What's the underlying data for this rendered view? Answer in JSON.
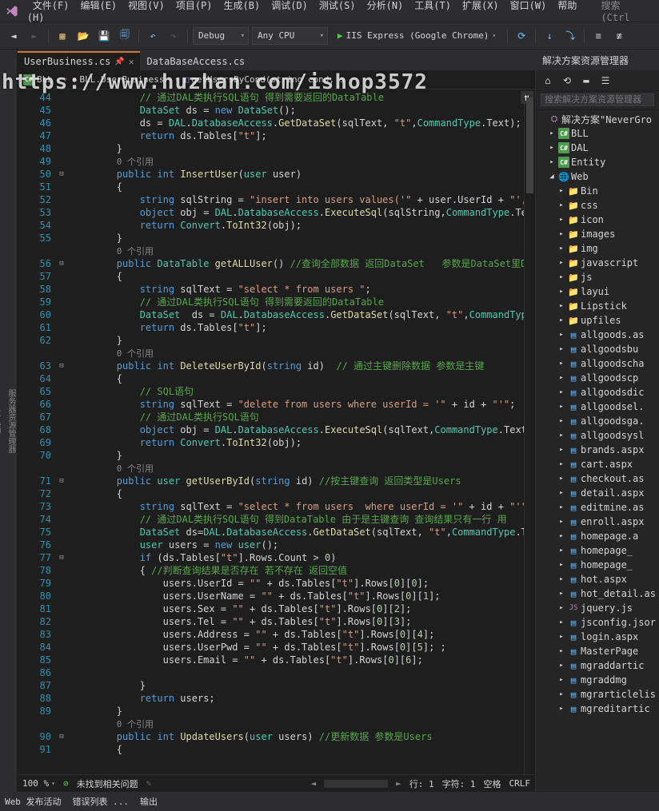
{
  "watermark": "https://www.huzhan.com/ishop3572",
  "menu": [
    "文件(F)",
    "编辑(E)",
    "视图(V)",
    "项目(P)",
    "生成(B)",
    "调试(D)",
    "测试(S)",
    "分析(N)",
    "工具(T)",
    "扩展(X)",
    "窗口(W)",
    "帮助(H)"
  ],
  "searchMenu": "搜索 (Ctrl",
  "toolbar": {
    "config": "Debug",
    "platform": "Any CPU",
    "run": "IIS Express (Google Chrome)"
  },
  "tabs": [
    {
      "label": "UserBusiness.cs",
      "active": true,
      "locked": true
    },
    {
      "label": "DataBaseAccess.cs",
      "active": false,
      "locked": false
    }
  ],
  "breadcrumb": {
    "a": "BLL",
    "b": "BLL.UserBusiness",
    "c": "getUsersByCond(string cond, s"
  },
  "editor_status": {
    "zoom": "100 %",
    "issues": "未找到相关问题",
    "line": "行: 1",
    "col": "字符: 1",
    "ins": "空格",
    "enc": "CRLF"
  },
  "bottom_tabs": [
    "Web 发布活动",
    "错误列表 ...",
    "输出"
  ],
  "solution": {
    "title": "解决方案资源管理器",
    "search": "搜索解决方案资源管理器",
    "root": "解决方案\"NeverGro",
    "projects": [
      "BLL",
      "DAL",
      "Entity"
    ],
    "web": "Web",
    "folders": [
      "Bin",
      "css",
      "icon",
      "images",
      "img",
      "javascript",
      "js",
      "layui",
      "Lipstick",
      "upfiles"
    ],
    "files": [
      "allgoods.as",
      "allgoodsbu",
      "allgoodscha",
      "allgoodscp",
      "allgoodsdic",
      "allgoodsel.",
      "allgoodsga.",
      "allgoodsysl",
      "brands.aspx",
      "cart.aspx",
      "checkout.as",
      "detail.aspx",
      "editmine.as",
      "enroll.aspx",
      "homepage.a",
      "homepage_",
      "homepage_",
      "hot.aspx",
      "hot_detail.as",
      "jquery.js",
      "jsconfig.jsor",
      "login.aspx",
      "MasterPage",
      "mgraddartic",
      "mgraddmg",
      "mgrarticlelis",
      "mgreditartic"
    ]
  },
  "code": {
    "start": 44,
    "lines": [
      {
        "n": 44,
        "f": "",
        "t": "            <span class='cmt'>// 通过DAL类执行SQL语句 得到需要返回的DataTable</span>"
      },
      {
        "n": 45,
        "f": "",
        "t": "            <span class='type'>DataSet</span> <span class='id'>ds</span> = <span class='kw'>new</span> <span class='type'>DataSet</span>();"
      },
      {
        "n": 46,
        "f": "",
        "t": "            <span class='id'>ds</span> = <span class='type'>DAL</span>.<span class='type'>DatabaseAccess</span>.<span class='mth'>GetDataSet</span>(<span class='id'>sqlText</span>, <span class='str'>\"t\"</span>,<span class='type'>CommandType</span>.<span class='id'>Text</span>);"
      },
      {
        "n": 47,
        "f": "",
        "t": "            <span class='kw'>return</span> <span class='id'>ds</span>.<span class='id'>Tables</span>[<span class='str'>\"t\"</span>];"
      },
      {
        "n": 48,
        "f": "",
        "t": "        }"
      },
      {
        "n": 49,
        "f": "",
        "t": "        <span class='ref'>0 个引用</span>"
      },
      {
        "n": 50,
        "f": "⊟",
        "t": "        <span class='kw'>public</span> <span class='kw'>int</span> <span class='mth'>InsertUser</span>(<span class='type'>user</span> <span class='id'>user</span>)"
      },
      {
        "n": 51,
        "f": "",
        "t": "        {"
      },
      {
        "n": 52,
        "f": "",
        "t": "            <span class='kw'>string</span> <span class='id'>sqlString</span> = <span class='str'>\"insert into users values('\"</span> + <span class='id'>user</span>.<span class='id'>UserId</span> + <span class='str'>\"','\"</span> +"
      },
      {
        "n": 53,
        "f": "",
        "t": "            <span class='kw'>object</span> <span class='id'>obj</span> = <span class='type'>DAL</span>.<span class='type'>DatabaseAccess</span>.<span class='mth'>ExecuteSql</span>(<span class='id'>sqlString</span>,<span class='type'>CommandType</span>.<span class='id'>Text</span>);"
      },
      {
        "n": 54,
        "f": "",
        "t": "            <span class='kw'>return</span> <span class='type'>Convert</span>.<span class='mth'>ToInt32</span>(<span class='id'>obj</span>);"
      },
      {
        "n": 55,
        "f": "",
        "t": "        }"
      },
      {
        "n": "",
        "f": "",
        "t": "        <span class='ref'>0 个引用</span>"
      },
      {
        "n": 56,
        "f": "⊟",
        "t": "        <span class='kw'>public</span> <span class='type'>DataTable</span> <span class='mth'>getALLUser</span>() <span class='cmt'>//查询全部数据 返回DataSet   参数是DataSet里Da</span>"
      },
      {
        "n": 57,
        "f": "",
        "t": "        {"
      },
      {
        "n": 58,
        "f": "",
        "t": "            <span class='kw'>string</span> <span class='id'>sqlText</span> = <span class='str'>\"select * from users \"</span>;"
      },
      {
        "n": 59,
        "f": "",
        "t": "            <span class='cmt'>// 通过DAL类执行SQL语句 得到需要返回的DataTable</span>"
      },
      {
        "n": 60,
        "f": "",
        "t": "            <span class='type'>DataSet</span>  <span class='id'>ds</span> = <span class='type'>DAL</span>.<span class='type'>DatabaseAccess</span>.<span class='mth'>GetDataSet</span>(<span class='id'>sqlText</span>, <span class='str'>\"t\"</span>,<span class='type'>CommandType</span>.<span class='id'>Tex</span>"
      },
      {
        "n": 61,
        "f": "",
        "t": "            <span class='kw'>return</span> <span class='id'>ds</span>.<span class='id'>Tables</span>[<span class='str'>\"t\"</span>];"
      },
      {
        "n": 62,
        "f": "",
        "t": "        }"
      },
      {
        "n": "",
        "f": "",
        "t": "        <span class='ref'>0 个引用</span>"
      },
      {
        "n": 63,
        "f": "⊟",
        "t": "        <span class='kw'>public</span> <span class='kw'>int</span> <span class='mth'>DeleteUserById</span>(<span class='kw'>string</span> <span class='id'>id</span>)  <span class='cmt'>// 通过主键删除数据 参数是主键</span>"
      },
      {
        "n": 64,
        "f": "",
        "t": "        {"
      },
      {
        "n": 65,
        "f": "",
        "t": "            <span class='cmt'>// SQL语句</span>"
      },
      {
        "n": 66,
        "f": "",
        "t": "            <span class='kw'>string</span> <span class='id'>sqlText</span> = <span class='str'>\"delete from users where userId = '\"</span> + <span class='id'>id</span> + <span class='str'>\"'\"</span>;"
      },
      {
        "n": 67,
        "f": "",
        "t": "            <span class='cmt'>// 通过DAL类执行SQL语句</span>"
      },
      {
        "n": 68,
        "f": "",
        "t": "            <span class='kw'>object</span> <span class='id'>obj</span> = <span class='type'>DAL</span>.<span class='type'>DatabaseAccess</span>.<span class='mth'>ExecuteSql</span>(<span class='id'>sqlText</span>,<span class='type'>CommandType</span>.<span class='id'>Text</span>);"
      },
      {
        "n": 69,
        "f": "",
        "t": "            <span class='kw'>return</span> <span class='type'>Convert</span>.<span class='mth'>ToInt32</span>(<span class='id'>obj</span>);"
      },
      {
        "n": 70,
        "f": "",
        "t": "        }"
      },
      {
        "n": "",
        "f": "",
        "t": "        <span class='ref'>0 个引用</span>"
      },
      {
        "n": 71,
        "f": "⊟",
        "t": "        <span class='kw'>public</span> <span class='type'>user</span> <span class='mth'>getUserById</span>(<span class='kw'>string</span> <span class='id'>id</span>) <span class='cmt'>//按主键查询 返回类型是Users</span>"
      },
      {
        "n": 72,
        "f": "",
        "t": "        {"
      },
      {
        "n": 73,
        "f": "",
        "t": "            <span class='kw'>string</span> <span class='id'>sqlText</span> = <span class='str'>\"select * from users  where userId = '\"</span> + <span class='id'>id</span> + <span class='str'>\"'\"</span>"
      },
      {
        "n": 74,
        "f": "",
        "t": "            <span class='cmt'>// 通过DAL类执行SQL语句 得到DataTable 由于是主键查询 查询结果只有一行 用</span>"
      },
      {
        "n": 75,
        "f": "",
        "t": "            <span class='type'>DataSet</span> <span class='id'>ds</span>=<span class='type'>DAL</span>.<span class='type'>DatabaseAccess</span>.<span class='mth'>GetDataSet</span>(<span class='id'>sqlText</span>, <span class='str'>\"t\"</span>,<span class='type'>CommandType</span>.<span class='id'>Text</span>);"
      },
      {
        "n": 76,
        "f": "",
        "t": "            <span class='type'>user</span> <span class='id'>users</span> = <span class='kw'>new</span> <span class='type'>user</span>();"
      },
      {
        "n": 77,
        "f": "⊟",
        "t": "            <span class='kw'>if</span> (<span class='id'>ds</span>.<span class='id'>Tables</span>[<span class='str'>\"t\"</span>].<span class='id'>Rows</span>.<span class='id'>Count</span> > <span class='num'>0</span>)"
      },
      {
        "n": 78,
        "f": "",
        "t": "            { <span class='cmt'>//判断查询结果是否存在 若不存在 返回空值</span>"
      },
      {
        "n": 79,
        "f": "",
        "t": "                <span class='id'>users</span>.<span class='id'>UserId</span> = <span class='str'>\"\"</span> + <span class='id'>ds</span>.<span class='id'>Tables</span>[<span class='str'>\"t\"</span>].<span class='id'>Rows</span>[<span class='num'>0</span>][<span class='num'>0</span>];"
      },
      {
        "n": 80,
        "f": "",
        "t": "                <span class='id'>users</span>.<span class='id'>UserName</span> = <span class='str'>\"\"</span> + <span class='id'>ds</span>.<span class='id'>Tables</span>[<span class='str'>\"t\"</span>].<span class='id'>Rows</span>[<span class='num'>0</span>][<span class='num'>1</span>];"
      },
      {
        "n": 81,
        "f": "",
        "t": "                <span class='id'>users</span>.<span class='id'>Sex</span> = <span class='str'>\"\"</span> + <span class='id'>ds</span>.<span class='id'>Tables</span>[<span class='str'>\"t\"</span>].<span class='id'>Rows</span>[<span class='num'>0</span>][<span class='num'>2</span>];"
      },
      {
        "n": 82,
        "f": "",
        "t": "                <span class='id'>users</span>.<span class='id'>Tel</span> = <span class='str'>\"\"</span> + <span class='id'>ds</span>.<span class='id'>Tables</span>[<span class='str'>\"t\"</span>].<span class='id'>Rows</span>[<span class='num'>0</span>][<span class='num'>3</span>];"
      },
      {
        "n": 83,
        "f": "",
        "t": "                <span class='id'>users</span>.<span class='id'>Address</span> = <span class='str'>\"\"</span> + <span class='id'>ds</span>.<span class='id'>Tables</span>[<span class='str'>\"t\"</span>].<span class='id'>Rows</span>[<span class='num'>0</span>][<span class='num'>4</span>];"
      },
      {
        "n": 84,
        "f": "",
        "t": "                <span class='id'>users</span>.<span class='id'>UserPwd</span> = <span class='str'>\"\"</span> + <span class='id'>ds</span>.<span class='id'>Tables</span>[<span class='str'>\"t\"</span>].<span class='id'>Rows</span>[<span class='num'>0</span>][<span class='num'>5</span>]; ;"
      },
      {
        "n": 85,
        "f": "",
        "t": "                <span class='id'>users</span>.<span class='id'>Email</span> = <span class='str'>\"\"</span> + <span class='id'>ds</span>.<span class='id'>Tables</span>[<span class='str'>\"t\"</span>].<span class='id'>Rows</span>[<span class='num'>0</span>][<span class='num'>6</span>];"
      },
      {
        "n": 86,
        "f": "",
        "t": ""
      },
      {
        "n": 87,
        "f": "",
        "t": "            }"
      },
      {
        "n": 88,
        "f": "",
        "t": "            <span class='kw'>return</span> <span class='id'>users</span>;"
      },
      {
        "n": 89,
        "f": "",
        "t": "        }"
      },
      {
        "n": "",
        "f": "",
        "t": "        <span class='ref'>0 个引用</span>"
      },
      {
        "n": 90,
        "f": "⊟",
        "t": "        <span class='kw'>public</span> <span class='kw'>int</span> <span class='mth'>UpdateUsers</span>(<span class='type'>user</span> <span class='id'>users</span>) <span class='cmt'>//更新数据 参数是Users</span>"
      },
      {
        "n": 91,
        "f": "",
        "t": "        {"
      }
    ]
  }
}
